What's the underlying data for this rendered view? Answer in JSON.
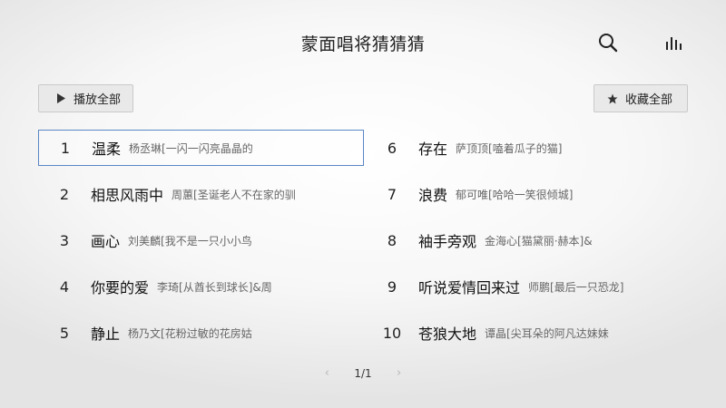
{
  "header": {
    "title": "蒙面唱将猜猜猜",
    "search_icon": "search-icon",
    "stats_icon": "bar-chart-icon"
  },
  "actions": {
    "play_all": "播放全部",
    "favorite_all": "收藏全部"
  },
  "songs": [
    {
      "num": "1",
      "title": "温柔",
      "artist": "杨丞琳[一闪一闪亮晶晶的"
    },
    {
      "num": "2",
      "title": "相思风雨中",
      "artist": "周蕙[圣诞老人不在家的驯"
    },
    {
      "num": "3",
      "title": "画心",
      "artist": "刘美麟[我不是一只小小鸟"
    },
    {
      "num": "4",
      "title": "你要的爱",
      "artist": "李琦[从酋长到球长]&周"
    },
    {
      "num": "5",
      "title": "静止",
      "artist": "杨乃文[花粉过敏的花房姑"
    },
    {
      "num": "6",
      "title": "存在",
      "artist": "萨顶顶[嗑着瓜子的猫]"
    },
    {
      "num": "7",
      "title": "浪费",
      "artist": "郁可唯[哈哈一笑很倾城]"
    },
    {
      "num": "8",
      "title": "袖手旁观",
      "artist": "金海心[猫黛丽·赫本]&"
    },
    {
      "num": "9",
      "title": "听说爱情回来过",
      "artist": "师鹏[最后一只恐龙]"
    },
    {
      "num": "10",
      "title": "苍狼大地",
      "artist": "谭晶[尖耳朵的阿凡达妹妹"
    }
  ],
  "pagination": {
    "current": "1/1"
  },
  "colors": {
    "selected_border": "#5a86c6"
  }
}
